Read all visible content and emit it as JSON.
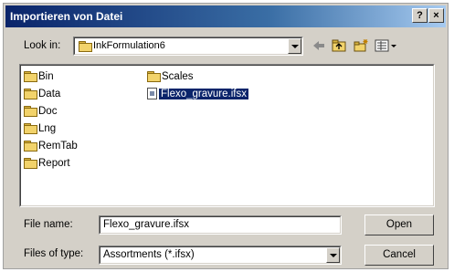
{
  "window": {
    "title": "Importieren von Datei"
  },
  "titlebar_buttons": {
    "help": "?",
    "close": "×"
  },
  "lookin": {
    "label": "Look in:",
    "value": "InkFormulation6"
  },
  "files": {
    "col1": [
      "Bin",
      "Data",
      "Doc",
      "Lng",
      "RemTab",
      "Report"
    ],
    "col2_folder": "Scales",
    "col2_file": "Flexo_gravure.ifsx"
  },
  "filename": {
    "label": "File name:",
    "value": "Flexo_gravure.ifsx"
  },
  "filetype": {
    "label": "Files of type:",
    "value": "Assortments (*.ifsx)"
  },
  "buttons": {
    "open": "Open",
    "cancel": "Cancel"
  }
}
